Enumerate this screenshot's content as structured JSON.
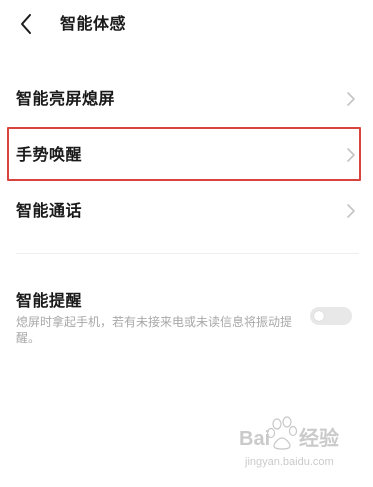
{
  "header": {
    "title": "智能体感",
    "back_icon": "chevron-left-icon"
  },
  "menu": {
    "items": [
      {
        "label": "智能亮屏熄屏",
        "icon": "chevron-right-icon"
      },
      {
        "label": "手势唤醒",
        "icon": "chevron-right-icon",
        "highlighted": true
      },
      {
        "label": "智能通话",
        "icon": "chevron-right-icon"
      }
    ]
  },
  "reminder": {
    "title": "智能提醒",
    "description": "熄屏时拿起手机，若有未接来电或未读信息将振动提醒。",
    "toggle_on": false
  },
  "watermark": {
    "brand": "Baidu 经验",
    "url": "jingyan.baidu.com"
  },
  "colors": {
    "highlight": "#d9453e",
    "text_primary": "#1a1a1a",
    "text_secondary": "#a8a8a8",
    "toggle_off": "#e8e8e8"
  }
}
